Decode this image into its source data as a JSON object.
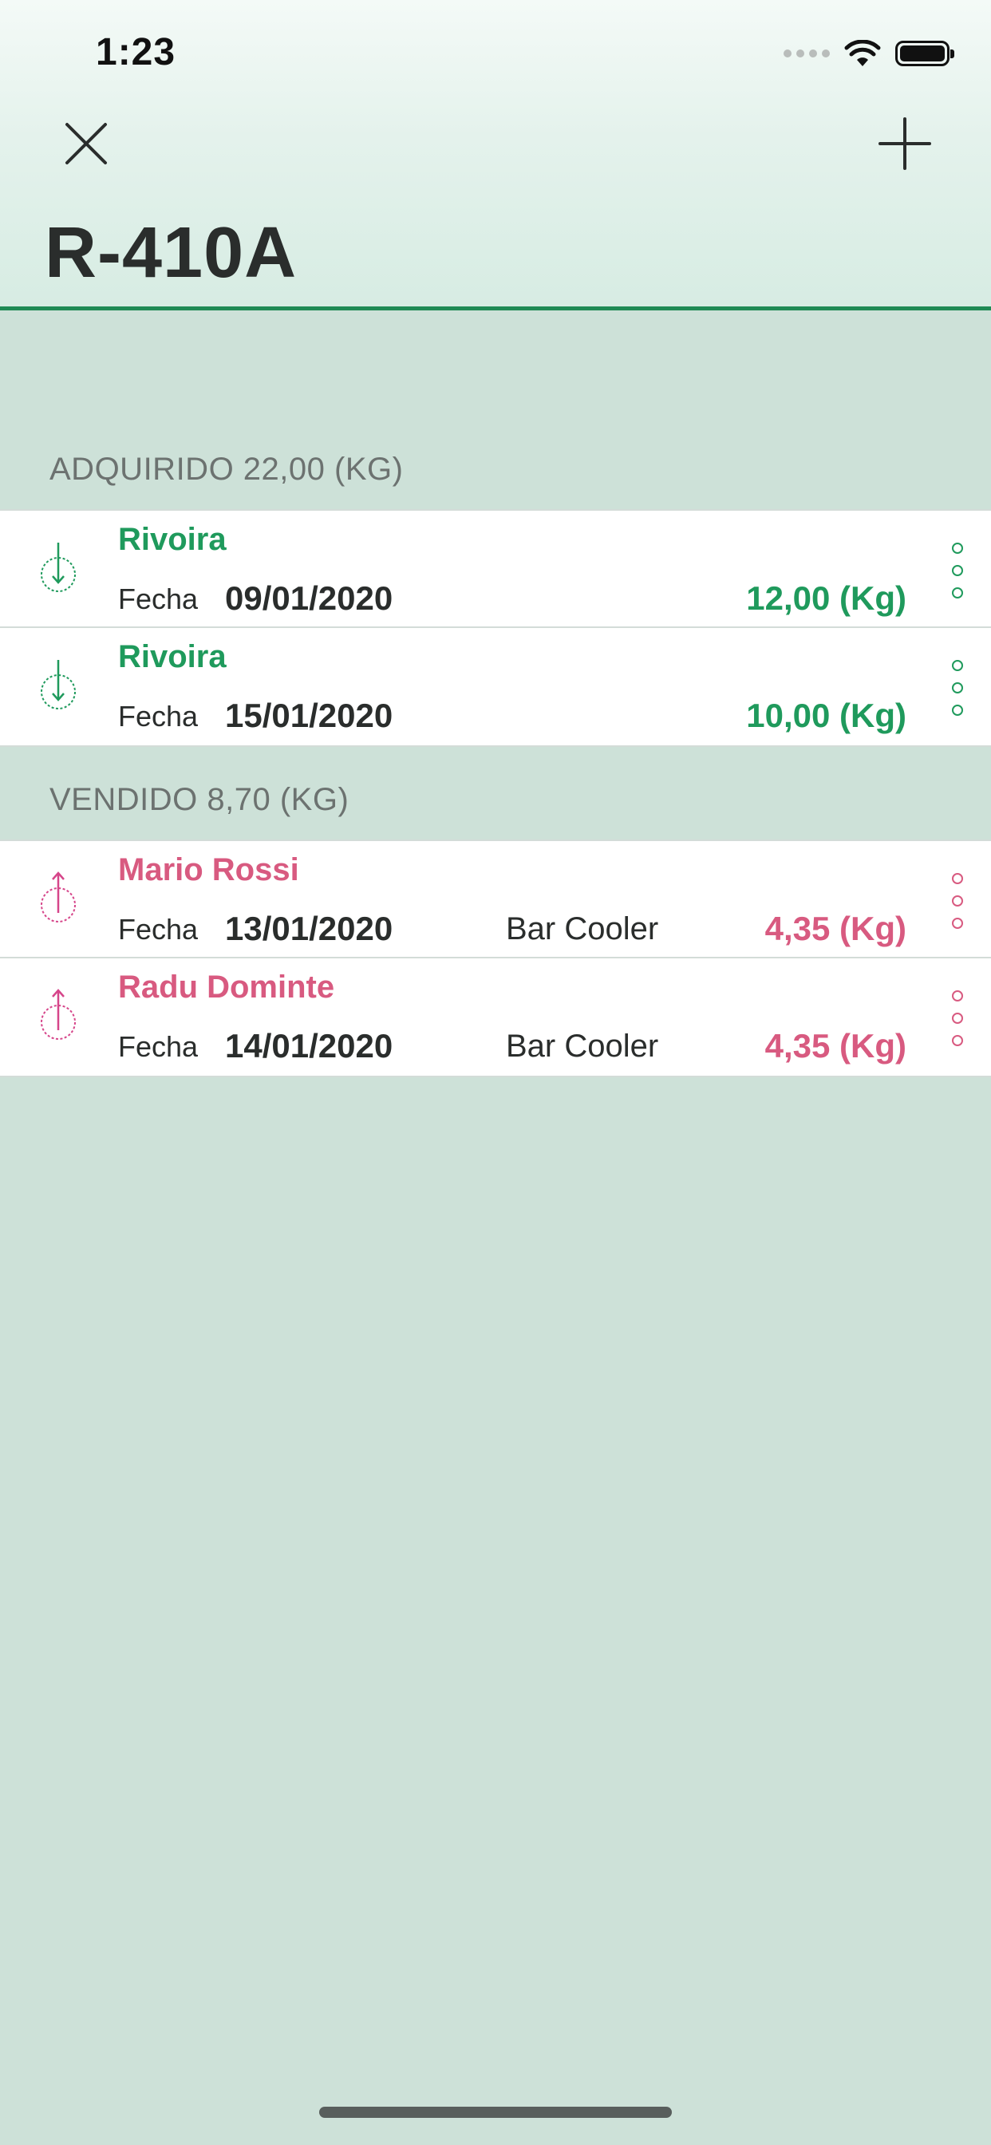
{
  "status_bar": {
    "time": "1:23"
  },
  "header": {
    "title": "R-410A",
    "close_icon": "close-icon",
    "add_icon": "plus-icon"
  },
  "colors": {
    "purchase": "#1f9a5c",
    "sale": "#d85a80",
    "accent_line": "#1f8a55",
    "background": "#cde1d8"
  },
  "purchased": {
    "header": "ADQUIRIDO 22,00 (KG)",
    "items": [
      {
        "name": "Rivoira",
        "date_label": "Fecha",
        "date": "09/01/2020",
        "amount": "12,00 (Kg)",
        "icon": "download-arrow-icon"
      },
      {
        "name": "Rivoira",
        "date_label": "Fecha",
        "date": "15/01/2020",
        "amount": "10,00 (Kg)",
        "icon": "download-arrow-icon"
      }
    ]
  },
  "sold": {
    "header": "VENDIDO 8,70 (KG)",
    "items": [
      {
        "name": "Mario Rossi",
        "date_label": "Fecha",
        "date": "13/01/2020",
        "equipment": "Bar Cooler",
        "amount": "4,35 (Kg)",
        "icon": "upload-arrow-icon"
      },
      {
        "name": "Radu Dominte",
        "date_label": "Fecha",
        "date": "14/01/2020",
        "equipment": "Bar Cooler",
        "amount": "4,35 (Kg)",
        "icon": "upload-arrow-icon"
      }
    ]
  }
}
